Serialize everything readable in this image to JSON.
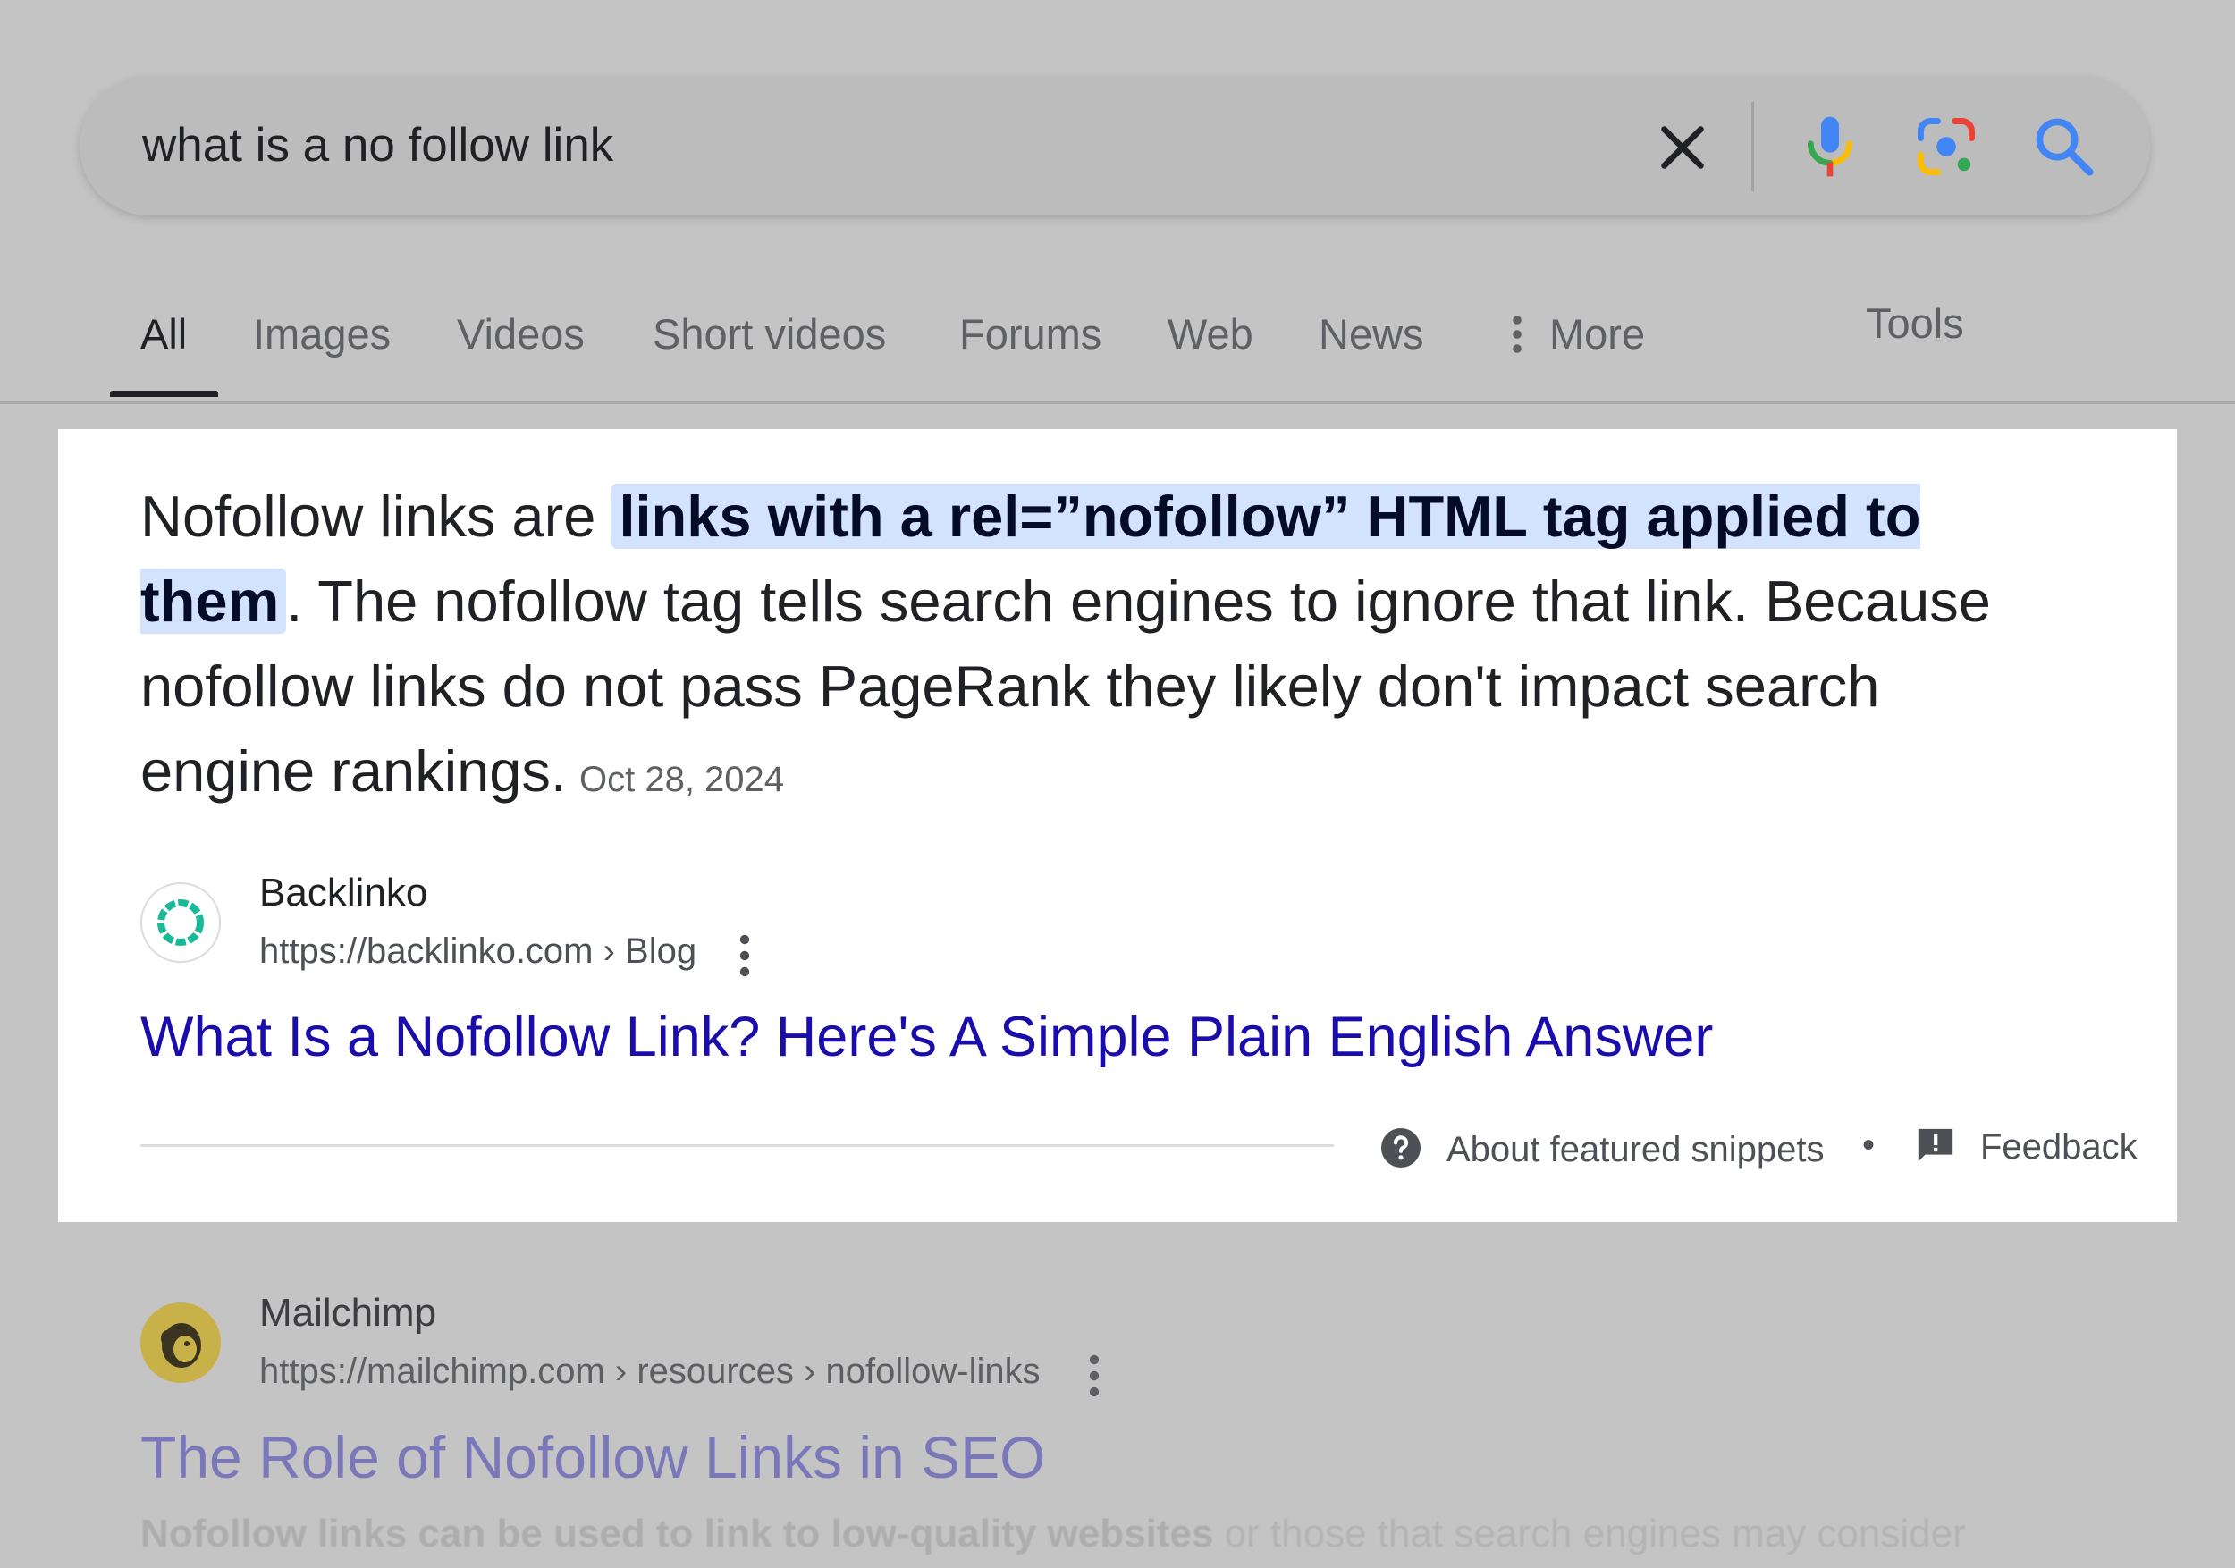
{
  "search": {
    "query": "what is a no follow link"
  },
  "tabs": {
    "all": "All",
    "images": "Images",
    "videos": "Videos",
    "short_videos": "Short videos",
    "forums": "Forums",
    "web": "Web",
    "news": "News",
    "more": "More",
    "tools": "Tools",
    "active": "All"
  },
  "icons": {
    "clear": "close-icon",
    "voice": "microphone-icon",
    "lens": "camera-lens-icon",
    "submit": "search-icon",
    "more": "vertical-dots-icon",
    "help": "question-circle-icon",
    "feedback": "feedback-flag-icon"
  },
  "featured_snippet": {
    "text_before": "Nofollow links are ",
    "highlight": "links with a rel=”nofollow” HTML tag applied to them",
    "text_after": ". The nofollow tag tells search engines to ignore that link. Because nofollow links do not pass PageRank they likely don't impact search engine rankings.",
    "date": "Oct 28, 2024",
    "source_name": "Backlinko",
    "source_url": "https://backlinko.com › Blog",
    "title": "What Is a Nofollow Link? Here's A Simple Plain English Answer",
    "about_label": "About featured snippets",
    "separator": "•",
    "feedback_label": "Feedback"
  },
  "result_2": {
    "source_name": "Mailchimp",
    "source_url": "https://mailchimp.com › resources › nofollow-links",
    "title": "The Role of Nofollow Links in SEO",
    "desc_bold": "Nofollow links can be used to link to low-quality websites",
    "desc_rest": " or those that search engines may consider"
  },
  "colors": {
    "page_background": "#c4c4c4",
    "highlight_background": "#d3e3fd",
    "link_blue": "#1a0dab",
    "google_blue": "#4285f4",
    "google_red": "#ea4335",
    "google_yellow": "#fbbc04",
    "google_green": "#34a853",
    "backlinko_green": "#1bb99a"
  }
}
